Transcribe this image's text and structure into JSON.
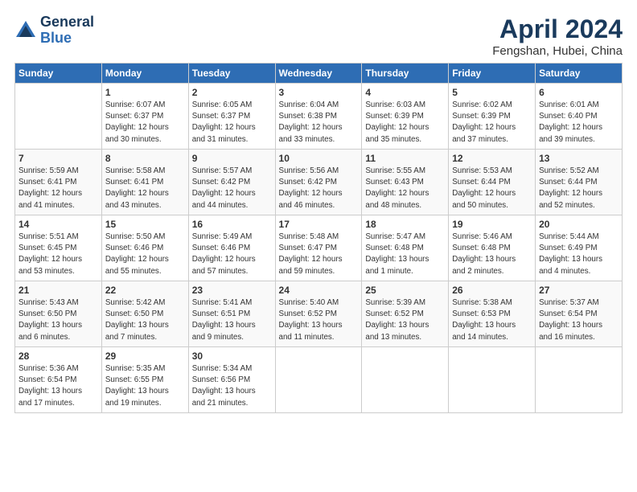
{
  "header": {
    "logo_line1": "General",
    "logo_line2": "Blue",
    "month": "April 2024",
    "location": "Fengshan, Hubei, China"
  },
  "weekdays": [
    "Sunday",
    "Monday",
    "Tuesday",
    "Wednesday",
    "Thursday",
    "Friday",
    "Saturday"
  ],
  "weeks": [
    [
      {
        "day": "",
        "text": ""
      },
      {
        "day": "1",
        "text": "Sunrise: 6:07 AM\nSunset: 6:37 PM\nDaylight: 12 hours\nand 30 minutes."
      },
      {
        "day": "2",
        "text": "Sunrise: 6:05 AM\nSunset: 6:37 PM\nDaylight: 12 hours\nand 31 minutes."
      },
      {
        "day": "3",
        "text": "Sunrise: 6:04 AM\nSunset: 6:38 PM\nDaylight: 12 hours\nand 33 minutes."
      },
      {
        "day": "4",
        "text": "Sunrise: 6:03 AM\nSunset: 6:39 PM\nDaylight: 12 hours\nand 35 minutes."
      },
      {
        "day": "5",
        "text": "Sunrise: 6:02 AM\nSunset: 6:39 PM\nDaylight: 12 hours\nand 37 minutes."
      },
      {
        "day": "6",
        "text": "Sunrise: 6:01 AM\nSunset: 6:40 PM\nDaylight: 12 hours\nand 39 minutes."
      }
    ],
    [
      {
        "day": "7",
        "text": "Sunrise: 5:59 AM\nSunset: 6:41 PM\nDaylight: 12 hours\nand 41 minutes."
      },
      {
        "day": "8",
        "text": "Sunrise: 5:58 AM\nSunset: 6:41 PM\nDaylight: 12 hours\nand 43 minutes."
      },
      {
        "day": "9",
        "text": "Sunrise: 5:57 AM\nSunset: 6:42 PM\nDaylight: 12 hours\nand 44 minutes."
      },
      {
        "day": "10",
        "text": "Sunrise: 5:56 AM\nSunset: 6:42 PM\nDaylight: 12 hours\nand 46 minutes."
      },
      {
        "day": "11",
        "text": "Sunrise: 5:55 AM\nSunset: 6:43 PM\nDaylight: 12 hours\nand 48 minutes."
      },
      {
        "day": "12",
        "text": "Sunrise: 5:53 AM\nSunset: 6:44 PM\nDaylight: 12 hours\nand 50 minutes."
      },
      {
        "day": "13",
        "text": "Sunrise: 5:52 AM\nSunset: 6:44 PM\nDaylight: 12 hours\nand 52 minutes."
      }
    ],
    [
      {
        "day": "14",
        "text": "Sunrise: 5:51 AM\nSunset: 6:45 PM\nDaylight: 12 hours\nand 53 minutes."
      },
      {
        "day": "15",
        "text": "Sunrise: 5:50 AM\nSunset: 6:46 PM\nDaylight: 12 hours\nand 55 minutes."
      },
      {
        "day": "16",
        "text": "Sunrise: 5:49 AM\nSunset: 6:46 PM\nDaylight: 12 hours\nand 57 minutes."
      },
      {
        "day": "17",
        "text": "Sunrise: 5:48 AM\nSunset: 6:47 PM\nDaylight: 12 hours\nand 59 minutes."
      },
      {
        "day": "18",
        "text": "Sunrise: 5:47 AM\nSunset: 6:48 PM\nDaylight: 13 hours\nand 1 minute."
      },
      {
        "day": "19",
        "text": "Sunrise: 5:46 AM\nSunset: 6:48 PM\nDaylight: 13 hours\nand 2 minutes."
      },
      {
        "day": "20",
        "text": "Sunrise: 5:44 AM\nSunset: 6:49 PM\nDaylight: 13 hours\nand 4 minutes."
      }
    ],
    [
      {
        "day": "21",
        "text": "Sunrise: 5:43 AM\nSunset: 6:50 PM\nDaylight: 13 hours\nand 6 minutes."
      },
      {
        "day": "22",
        "text": "Sunrise: 5:42 AM\nSunset: 6:50 PM\nDaylight: 13 hours\nand 7 minutes."
      },
      {
        "day": "23",
        "text": "Sunrise: 5:41 AM\nSunset: 6:51 PM\nDaylight: 13 hours\nand 9 minutes."
      },
      {
        "day": "24",
        "text": "Sunrise: 5:40 AM\nSunset: 6:52 PM\nDaylight: 13 hours\nand 11 minutes."
      },
      {
        "day": "25",
        "text": "Sunrise: 5:39 AM\nSunset: 6:52 PM\nDaylight: 13 hours\nand 13 minutes."
      },
      {
        "day": "26",
        "text": "Sunrise: 5:38 AM\nSunset: 6:53 PM\nDaylight: 13 hours\nand 14 minutes."
      },
      {
        "day": "27",
        "text": "Sunrise: 5:37 AM\nSunset: 6:54 PM\nDaylight: 13 hours\nand 16 minutes."
      }
    ],
    [
      {
        "day": "28",
        "text": "Sunrise: 5:36 AM\nSunset: 6:54 PM\nDaylight: 13 hours\nand 17 minutes."
      },
      {
        "day": "29",
        "text": "Sunrise: 5:35 AM\nSunset: 6:55 PM\nDaylight: 13 hours\nand 19 minutes."
      },
      {
        "day": "30",
        "text": "Sunrise: 5:34 AM\nSunset: 6:56 PM\nDaylight: 13 hours\nand 21 minutes."
      },
      {
        "day": "",
        "text": ""
      },
      {
        "day": "",
        "text": ""
      },
      {
        "day": "",
        "text": ""
      },
      {
        "day": "",
        "text": ""
      }
    ]
  ]
}
